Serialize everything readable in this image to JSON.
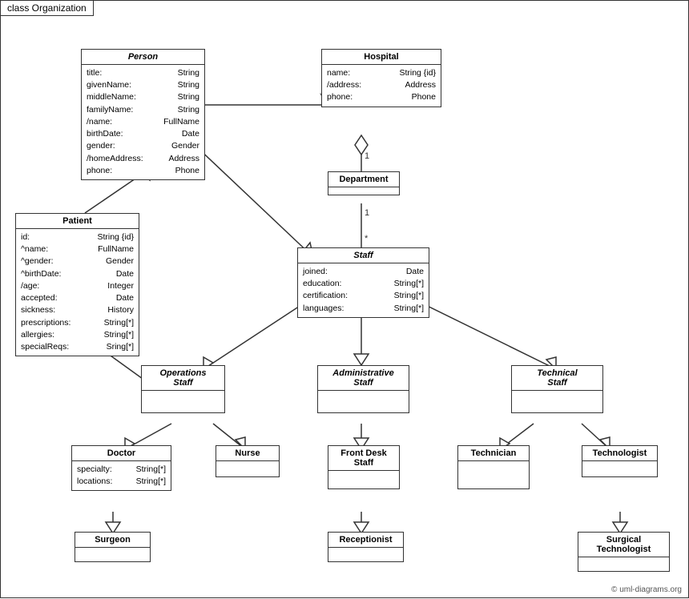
{
  "diagram": {
    "title": "class Organization",
    "copyright": "© uml-diagrams.org",
    "classes": {
      "person": {
        "name": "Person",
        "italic": true,
        "attrs": [
          {
            "name": "title:",
            "type": "String"
          },
          {
            "name": "givenName:",
            "type": "String"
          },
          {
            "name": "middleName:",
            "type": "String"
          },
          {
            "name": "familyName:",
            "type": "String"
          },
          {
            "name": "/name:",
            "type": "FullName"
          },
          {
            "name": "birthDate:",
            "type": "Date"
          },
          {
            "name": "gender:",
            "type": "Gender"
          },
          {
            "name": "/homeAddress:",
            "type": "Address"
          },
          {
            "name": "phone:",
            "type": "Phone"
          }
        ]
      },
      "hospital": {
        "name": "Hospital",
        "attrs": [
          {
            "name": "name:",
            "type": "String {id}"
          },
          {
            "name": "/address:",
            "type": "Address"
          },
          {
            "name": "phone:",
            "type": "Phone"
          }
        ]
      },
      "department": {
        "name": "Department",
        "attrs": []
      },
      "staff": {
        "name": "Staff",
        "italic": true,
        "attrs": [
          {
            "name": "joined:",
            "type": "Date"
          },
          {
            "name": "education:",
            "type": "String[*]"
          },
          {
            "name": "certification:",
            "type": "String[*]"
          },
          {
            "name": "languages:",
            "type": "String[*]"
          }
        ]
      },
      "patient": {
        "name": "Patient",
        "attrs": [
          {
            "name": "id:",
            "type": "String {id}"
          },
          {
            "name": "^name:",
            "type": "FullName"
          },
          {
            "name": "^gender:",
            "type": "Gender"
          },
          {
            "name": "^birthDate:",
            "type": "Date"
          },
          {
            "name": "/age:",
            "type": "Integer"
          },
          {
            "name": "accepted:",
            "type": "Date"
          },
          {
            "name": "sickness:",
            "type": "History"
          },
          {
            "name": "prescriptions:",
            "type": "String[*]"
          },
          {
            "name": "allergies:",
            "type": "String[*]"
          },
          {
            "name": "specialReqs:",
            "type": "Sring[*]"
          }
        ]
      },
      "operations_staff": {
        "name": "Operations Staff",
        "italic": true,
        "attrs": []
      },
      "administrative_staff": {
        "name": "Administrative Staff",
        "italic": true,
        "attrs": []
      },
      "technical_staff": {
        "name": "Technical Staff",
        "italic": true,
        "attrs": []
      },
      "doctor": {
        "name": "Doctor",
        "attrs": [
          {
            "name": "specialty:",
            "type": "String[*]"
          },
          {
            "name": "locations:",
            "type": "String[*]"
          }
        ]
      },
      "nurse": {
        "name": "Nurse",
        "attrs": []
      },
      "front_desk_staff": {
        "name": "Front Desk Staff",
        "attrs": []
      },
      "technician": {
        "name": "Technician",
        "attrs": []
      },
      "technologist": {
        "name": "Technologist",
        "attrs": []
      },
      "surgeon": {
        "name": "Surgeon",
        "attrs": []
      },
      "receptionist": {
        "name": "Receptionist",
        "attrs": []
      },
      "surgical_technologist": {
        "name": "Surgical Technologist",
        "attrs": []
      }
    }
  }
}
